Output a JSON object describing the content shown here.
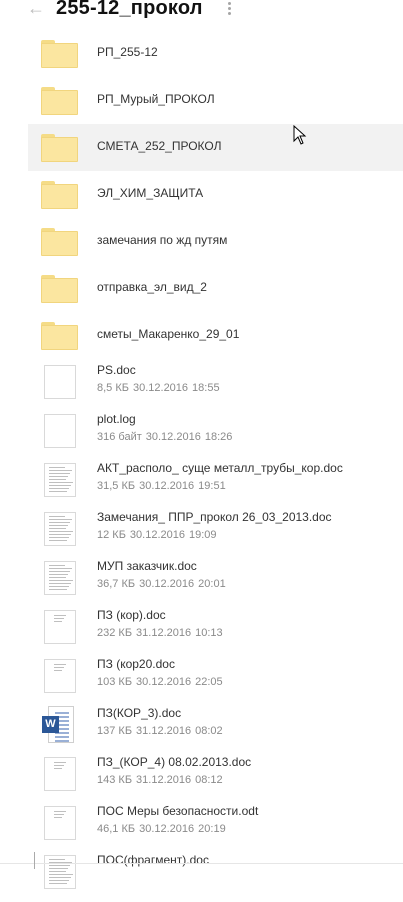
{
  "header": {
    "title": "255-12_прокол",
    "back_icon": "arrow-left-icon",
    "more_icon": "more-vertical-icon"
  },
  "folders": [
    {
      "name": "РП_255-12"
    },
    {
      "name": "РП_Мурый_ПРОКОЛ"
    },
    {
      "name": "СМЕТА_252_ПРОКОЛ",
      "selected": true
    },
    {
      "name": "ЭЛ_ХИМ_ЗАЩИТА"
    },
    {
      "name": "замечания по жд путям"
    },
    {
      "name": "отправка_эл_вид_2"
    },
    {
      "name": "сметы_Макаренко_29_01"
    }
  ],
  "files": [
    {
      "name": "PS.doc",
      "size": "8,5 КБ",
      "date": "30.12.2016",
      "time": "18:55",
      "icon": "blank"
    },
    {
      "name": "plot.log",
      "size": "316 байт",
      "date": "30.12.2016",
      "time": "18:26",
      "icon": "blank"
    },
    {
      "name": "АКТ_располо_ суще металл_трубы_кор.doc",
      "size": "31,5 КБ",
      "date": "30.12.2016",
      "time": "19:51",
      "icon": "text"
    },
    {
      "name": "Замечания_ ППР_прокол 26_03_2013.doc",
      "size": "12 КБ",
      "date": "30.12.2016",
      "time": "19:09",
      "icon": "text"
    },
    {
      "name": "МУП заказчик.doc",
      "size": "36,7 КБ",
      "date": "30.12.2016",
      "time": "20:01",
      "icon": "text"
    },
    {
      "name": "ПЗ (кор).doc",
      "size": "232 КБ",
      "date": "31.12.2016",
      "time": "10:13",
      "icon": "sparse"
    },
    {
      "name": "ПЗ (кор20.doc",
      "size": "103 КБ",
      "date": "30.12.2016",
      "time": "22:05",
      "icon": "sparse"
    },
    {
      "name": "ПЗ(КОР_3).doc",
      "size": "137 КБ",
      "date": "31.12.2016",
      "time": "08:02",
      "icon": "word"
    },
    {
      "name": "ПЗ_(КОР_4) 08.02.2013.doc",
      "size": "143 КБ",
      "date": "31.12.2016",
      "time": "08:12",
      "icon": "sparse"
    },
    {
      "name": "ПОС Меры безопасности.odt",
      "size": "46,1 КБ",
      "date": "30.12.2016",
      "time": "20:19",
      "icon": "sparse"
    },
    {
      "name": "ПОС(фрагмент).doc",
      "size": "",
      "date": "",
      "time": "",
      "icon": "text"
    }
  ],
  "colors": {
    "folder": "#fbe6a0",
    "selected_row": "#f2f2f2",
    "meta_text": "#8a8a8a",
    "word_badge": "#2b5797"
  }
}
